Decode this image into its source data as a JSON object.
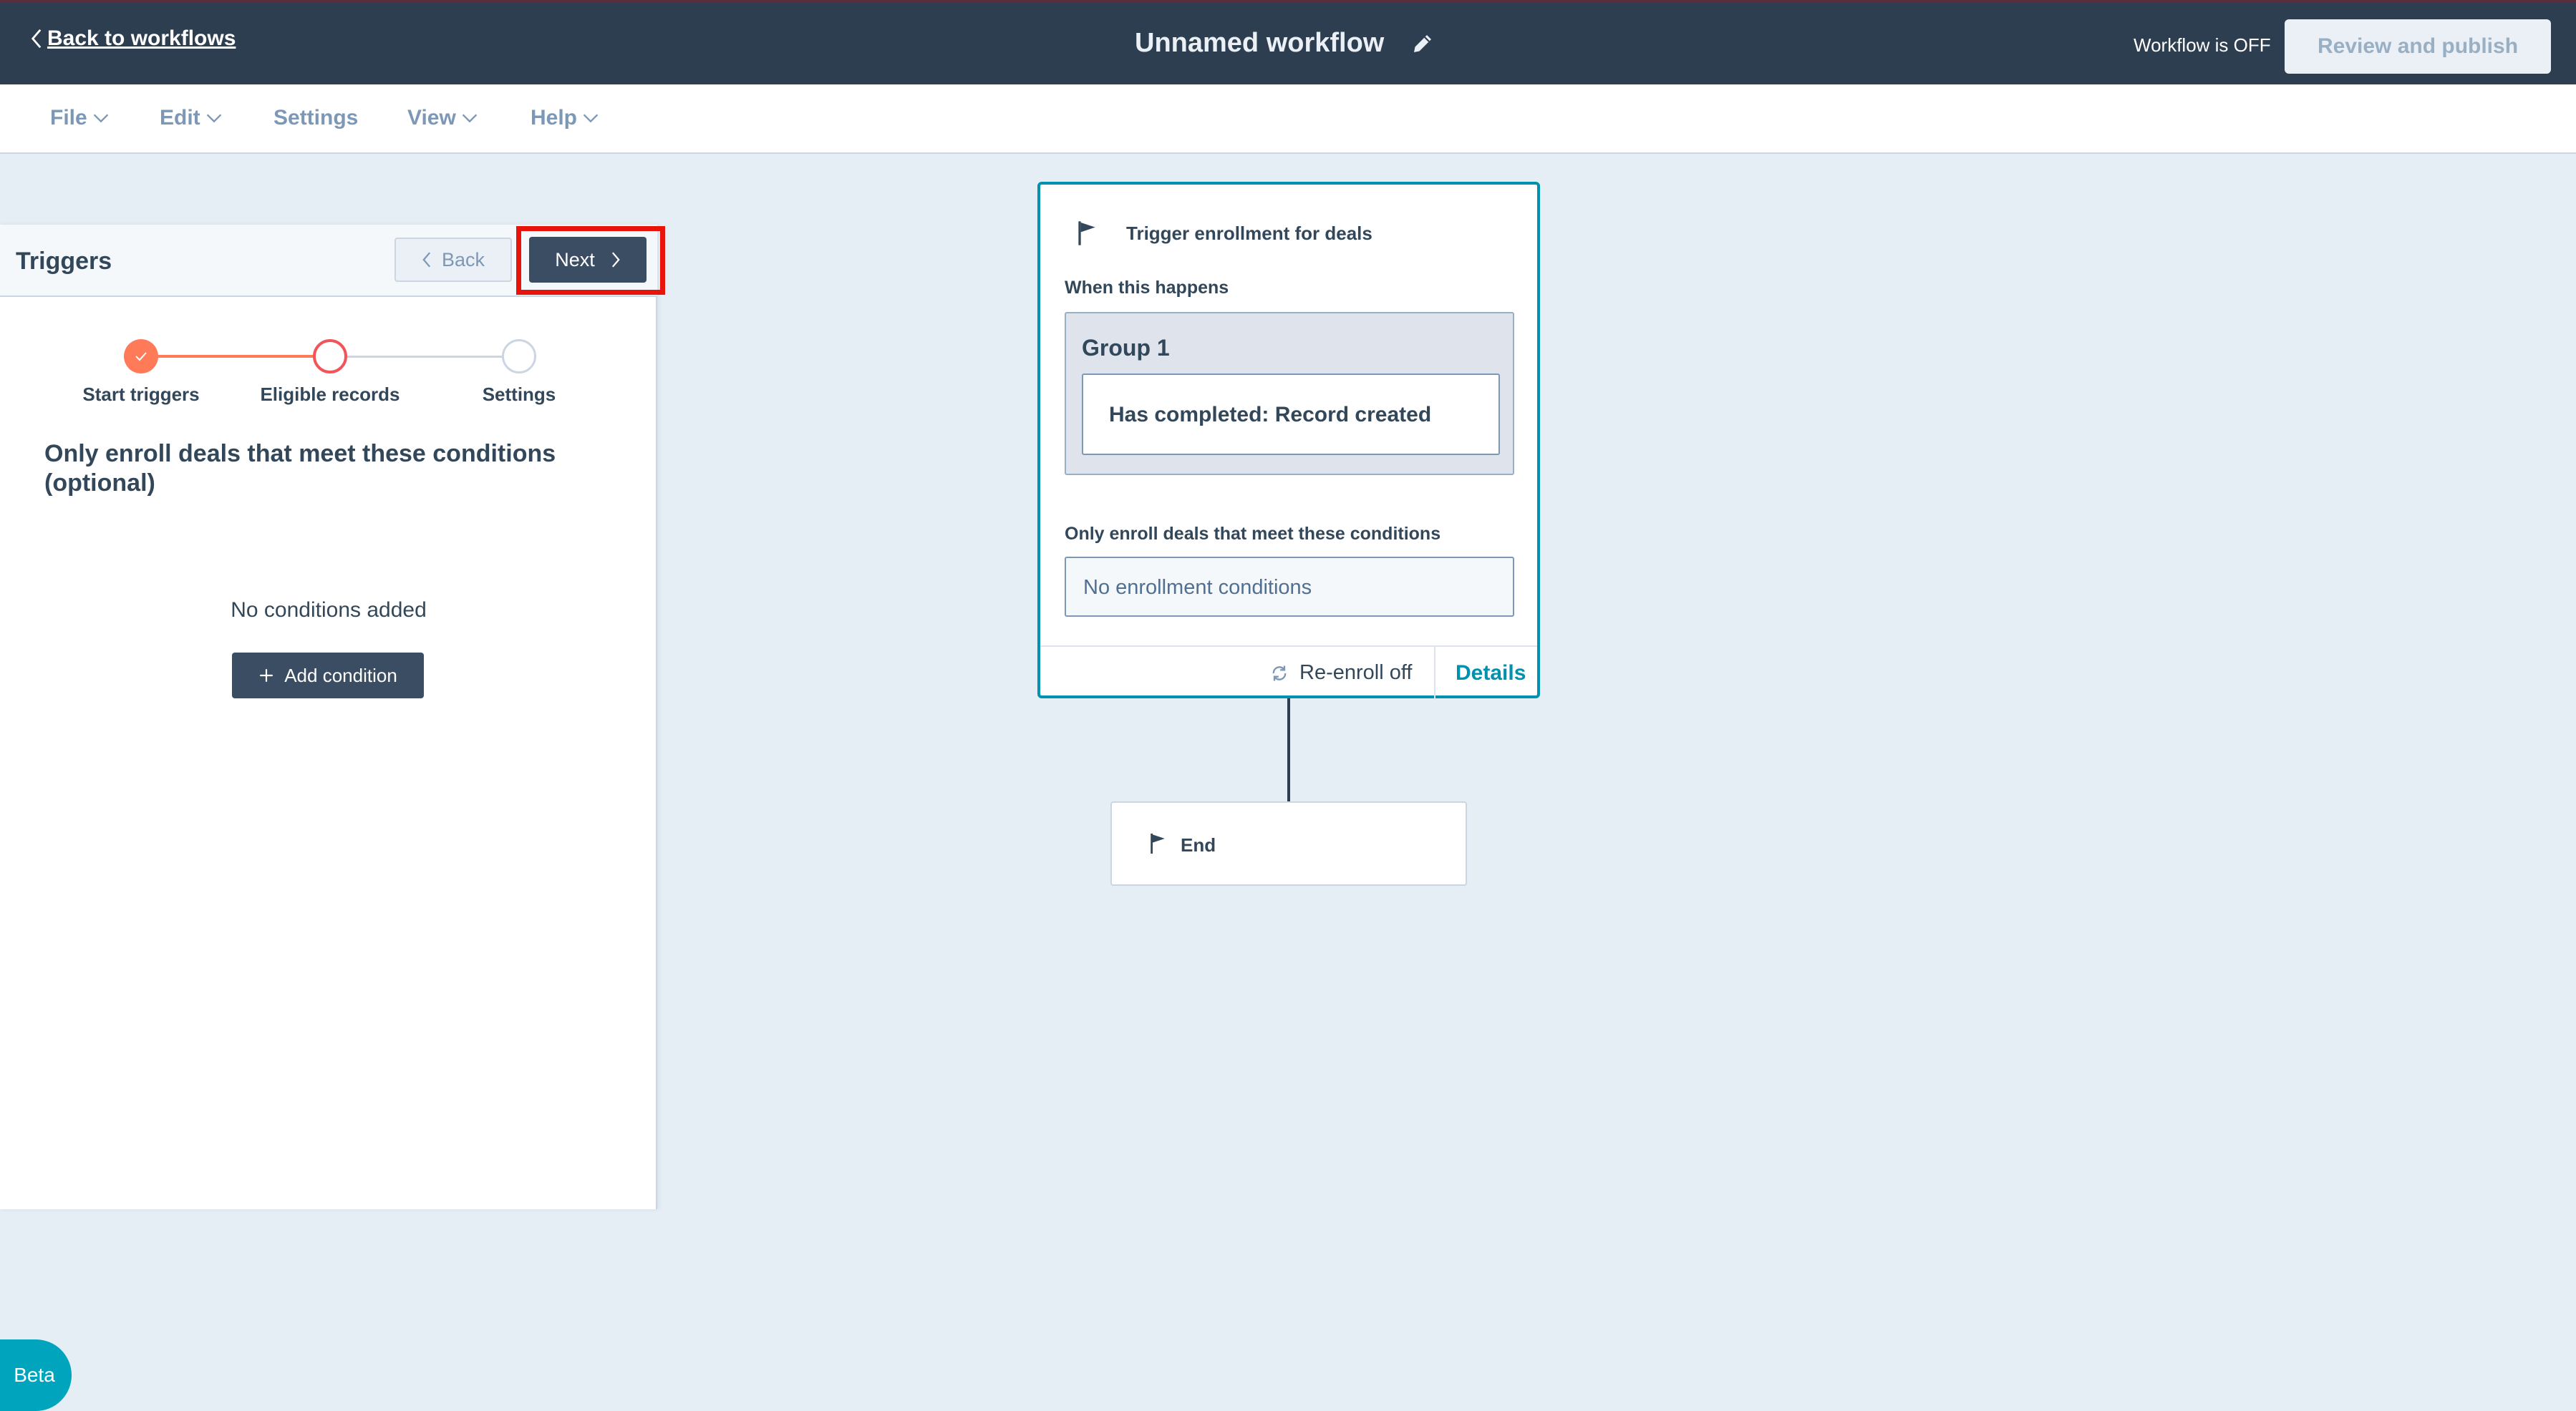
{
  "topbar": {
    "back_label": "Back to workflows",
    "workflow_title": "Unnamed workflow",
    "status_text": "Workflow is OFF",
    "publish_label": "Review and publish"
  },
  "menu": {
    "items": [
      "File",
      "Edit",
      "Settings",
      "View",
      "Help"
    ]
  },
  "panel": {
    "title": "Triggers",
    "back_label": "Back",
    "next_label": "Next",
    "steps": [
      {
        "label": "Start triggers",
        "state": "complete"
      },
      {
        "label": "Eligible records",
        "state": "current"
      },
      {
        "label": "Settings",
        "state": "upcoming"
      }
    ],
    "section_heading": "Only enroll deals that meet these conditions (optional)",
    "empty_text": "No conditions added",
    "add_condition_label": "Add condition",
    "beta_label": "Beta"
  },
  "canvas": {
    "trigger_card": {
      "title": "Trigger enrollment for deals",
      "when_label": "When this happens",
      "group_title": "Group 1",
      "group_condition": "Has completed: Record created",
      "only_label": "Only enroll deals that meet these conditions",
      "no_conditions": "No enrollment conditions",
      "reenroll_label": "Re-enroll off",
      "details_label": "Details"
    },
    "end_card": {
      "label": "End"
    }
  },
  "colors": {
    "topbar_bg": "#2d3e50",
    "canvas_bg": "#e5edf5",
    "accent_orange": "#ff7a59",
    "accent_teal": "#0091ae",
    "highlight_red": "#e8140c"
  },
  "icons": {
    "back": "chevron-left-icon",
    "edit": "pencil-icon",
    "menu_caret": "chevron-down-icon",
    "next": "chevron-right-icon",
    "add": "plus-icon",
    "trigger": "flag-icon",
    "reenroll": "refresh-icon",
    "end": "flag-icon"
  }
}
